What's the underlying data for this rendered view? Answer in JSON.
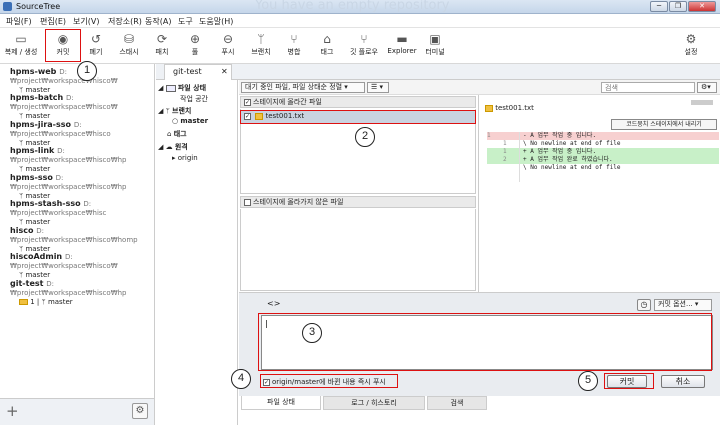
{
  "window": {
    "title": "SourceTree",
    "ghost_text": "You have an empty repository",
    "controls": [
      "─",
      "❐",
      "✕"
    ]
  },
  "menu": [
    "파일(F)",
    "편집(E)",
    "보기(V)",
    "저장소(R)",
    "동작(A)",
    "도구",
    "도움말(H)"
  ],
  "toolbar": {
    "items": [
      {
        "label": "복제 / 생성",
        "icon": "clone-icon",
        "glyph": "▭"
      },
      {
        "label": "커밋",
        "icon": "commit-icon",
        "glyph": "◉"
      },
      {
        "label": "폐기",
        "icon": "discard-icon",
        "glyph": "↺"
      },
      {
        "label": "스태시",
        "icon": "stash-icon",
        "glyph": "⛁"
      },
      {
        "label": "패치",
        "icon": "fetch-icon",
        "glyph": "⟳"
      },
      {
        "label": "풀",
        "icon": "pull-icon",
        "glyph": "⊕"
      },
      {
        "label": "푸시",
        "icon": "push-icon",
        "glyph": "⊖"
      },
      {
        "label": "브랜치",
        "icon": "branch-icon",
        "glyph": "ᛘ"
      },
      {
        "label": "병합",
        "icon": "merge-icon",
        "glyph": "⑂"
      },
      {
        "label": "태그",
        "icon": "tag-icon",
        "glyph": "⌂"
      },
      {
        "label": "깃 플로우",
        "icon": "git-flow-icon",
        "glyph": "⑂"
      },
      {
        "label": "Explorer",
        "icon": "folder-icon",
        "glyph": "▬"
      },
      {
        "label": "터미널",
        "icon": "terminal-icon",
        "glyph": "▣"
      }
    ],
    "settings_label": "설정"
  },
  "repos": [
    {
      "name": "hpms-web",
      "path": "D:₩project₩workspace₩hisco₩",
      "branch": "master"
    },
    {
      "name": "hpms-batch",
      "path": "D:₩project₩workspace₩hisco₩",
      "branch": "master"
    },
    {
      "name": "hpms-jira-sso",
      "path": "D:₩project₩workspace₩hisco",
      "branch": "master"
    },
    {
      "name": "hpms-link",
      "path": "D:₩project₩workspace₩hisco₩hp",
      "branch": "master"
    },
    {
      "name": "hpms-sso",
      "path": "D:₩project₩workspace₩hisco₩hp",
      "branch": "master"
    },
    {
      "name": "hpms-stash-sso",
      "path": "D:₩project₩workspace₩hisc",
      "branch": "master"
    },
    {
      "name": "hisco",
      "path": "D:₩project₩workspace₩hisco₩homp",
      "branch": "master"
    },
    {
      "name": "hiscoAdmin",
      "path": "D:₩project₩workspace₩hisco₩",
      "branch": "master"
    },
    {
      "name": "git-test",
      "path": "D:₩project₩workspace₩hisco₩hp",
      "branch": "master",
      "badge": "1"
    }
  ],
  "repo_tab": {
    "title": "git-test",
    "close": "✕"
  },
  "tree": {
    "file_status": "파일 상태",
    "working_copy": "작업 공간",
    "branches": "브랜치",
    "branch_master": "master",
    "tags": "태그",
    "remotes": "원격",
    "remote_origin": "origin"
  },
  "filter": {
    "view_select": "대기 중인 파일, 파일 상태순 정렬",
    "list_select": "☰",
    "search_placeholder": "검색"
  },
  "staged": {
    "header": "스테이지에 올라간 파일",
    "files": [
      "test001.txt"
    ]
  },
  "unstaged": {
    "header": "스테이지에 올라가지 않은 파일"
  },
  "diff": {
    "filename": "test001.txt",
    "unstage_button": "코드뭉치 스테이지에서 내리기",
    "lines": [
      {
        "old": "1",
        "new": "",
        "text": "- A 업무 작업 중 입니다.",
        "type": "del"
      },
      {
        "old": "",
        "new": "1",
        "text": "\\  No newline at end of file",
        "type": "ctx"
      },
      {
        "old": "",
        "new": "1",
        "text": "+ A 업무 작업 중 입니다.",
        "type": "add"
      },
      {
        "old": "",
        "new": "2",
        "text": "+ A 업무 작업 완료 하였습니다.",
        "type": "add"
      },
      {
        "old": "",
        "new": "",
        "text": "\\  No newline at end of file",
        "type": "ctx"
      }
    ]
  },
  "commit": {
    "avatar_text": "<>",
    "options_label": "커밋 옵션...",
    "message": "|",
    "push_checkbox_label": "origin/master에 바뀐 내용 즉시 푸시",
    "commit_button": "커밋",
    "cancel_button": "취소"
  },
  "bottom_tabs": [
    "파일 상태",
    "로그 / 히스토리",
    "검색"
  ],
  "callouts": [
    "1",
    "2",
    "3",
    "4",
    "5"
  ],
  "colors": {
    "callout_border": "#dd1111",
    "staged_row": "#c9d3e0",
    "add_bg": "#c8f0c8",
    "del_bg": "#f7d0d0"
  }
}
